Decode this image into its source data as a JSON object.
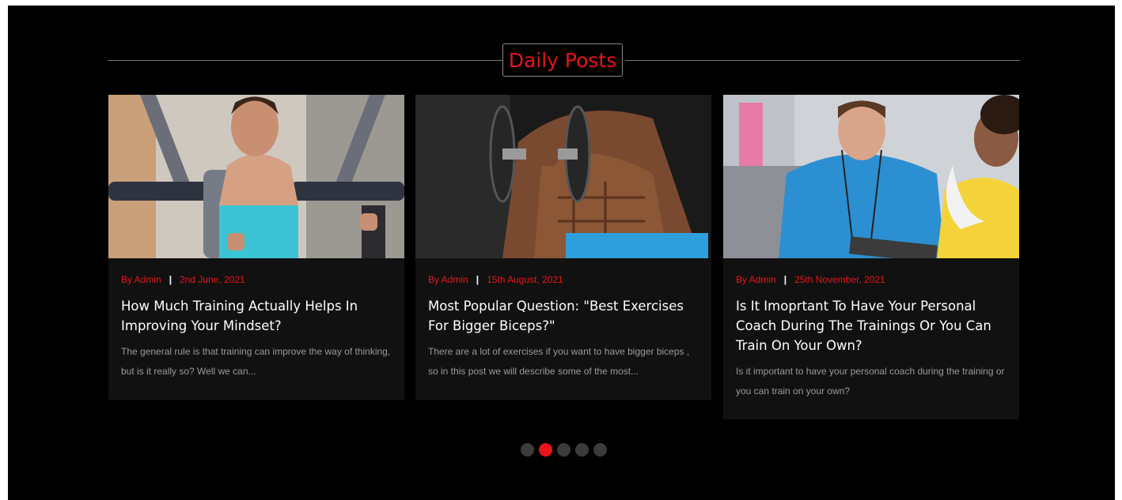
{
  "section": {
    "title": "Daily Posts"
  },
  "colors": {
    "accent": "#e8141b",
    "background": "#000000",
    "card": "#111111",
    "dot_inactive": "#3b3b3b"
  },
  "posts": [
    {
      "author": "By Admin",
      "date": "2nd June, 2021",
      "title": "How Much Training Actually Helps In Improving Your Mindset?",
      "excerpt": "The general rule is that training can improve the way of thinking, but is it really so? Well we can..."
    },
    {
      "author": "By Admin",
      "date": "15th August, 2021",
      "title": "Most Popular Question: \"Best Exercises For Bigger Biceps?\"",
      "excerpt": "There are a lot of exercises if you want to have bigger biceps , so in this post we will describe some of the most..."
    },
    {
      "author": "By Admin",
      "date": "25th November, 2021",
      "title": "Is It Imoprtant To Have Your Personal Coach During The Trainings Or You Can Train On Your Own?",
      "excerpt": "Is it important to have your personal coach during the training or you can train on your own?"
    }
  ],
  "pagination": {
    "count": 5,
    "active_index": 1
  }
}
